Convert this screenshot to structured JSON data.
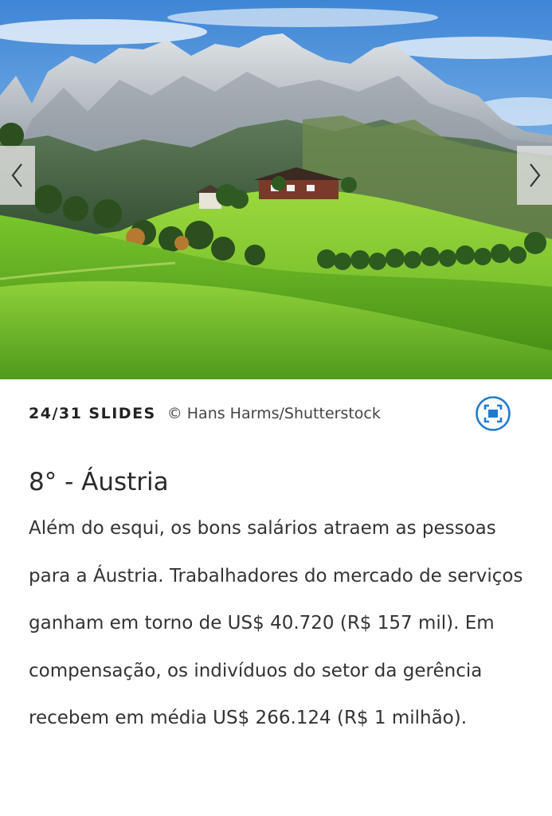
{
  "slideshow": {
    "counter": "24/31 SLIDES",
    "credit": "© Hans Harms/Shutterstock",
    "image_subject": "alpine-meadow-landscape",
    "prev_icon": "chevron-left-icon",
    "next_icon": "chevron-right-icon",
    "fullscreen_icon": "fullscreen-icon"
  },
  "article": {
    "title": "8° - Áustria",
    "body": "Além do esqui, os bons salários atraem as pessoas para a Áustria. Trabalhadores do mercado de serviços ganham em torno de US$ 40.720 (R$ 157 mil). Em compensação, os indivíduos do setor da gerência recebem em média US$ 266.124 (R$ 1 milhão)."
  },
  "colors": {
    "accent": "#1e7ad0",
    "text": "#333333",
    "arrow_bg": "#e1e1e1"
  }
}
